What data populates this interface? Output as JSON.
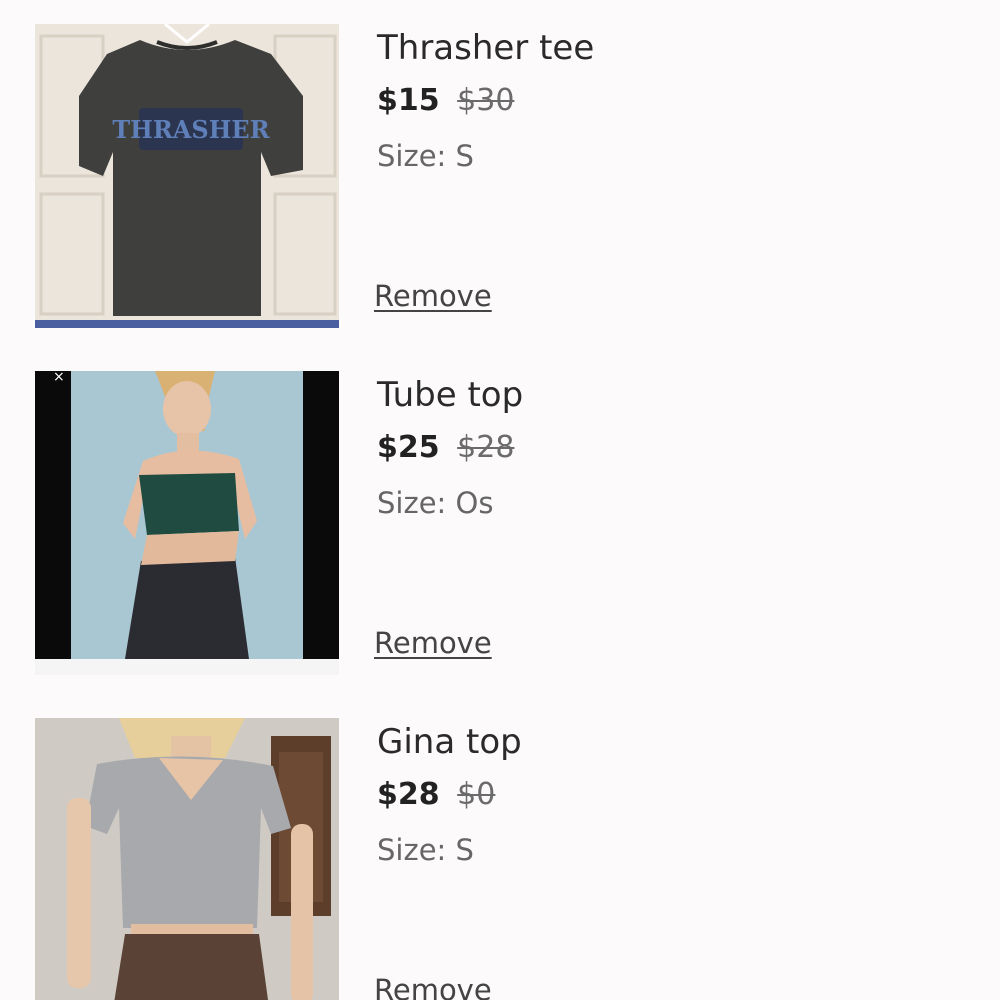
{
  "cart": {
    "items": [
      {
        "title": "Thrasher tee",
        "price": "$15",
        "original_price": "$30",
        "size_text": "Size: S",
        "remove_label": "Remove",
        "image": "thrasher-tshirt-photo"
      },
      {
        "title": "Tube top",
        "price": "$25",
        "original_price": "$28",
        "size_text": "Size: Os",
        "remove_label": "Remove",
        "image": "green-tube-top-photo"
      },
      {
        "title": "Gina top",
        "price": "$28",
        "original_price": "$0",
        "size_text": "Size: S",
        "remove_label": "Remove",
        "image": "grey-gina-top-photo"
      }
    ]
  },
  "colors": {
    "background": "#fcfafb",
    "text": "#2a2a2a",
    "muted": "#666666"
  }
}
